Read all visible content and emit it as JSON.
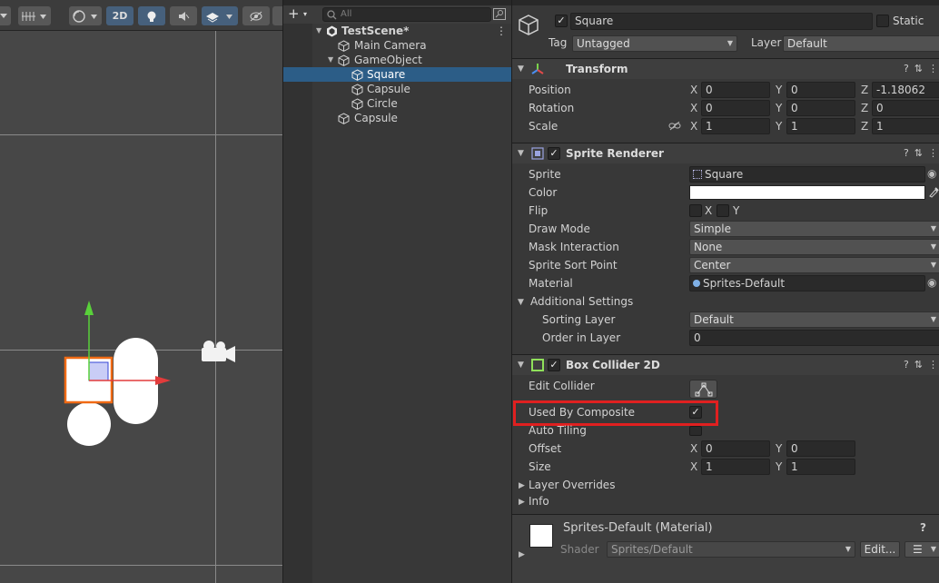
{
  "scene": {
    "mode_2d": "2D"
  },
  "hierarchy": {
    "search_placeholder": "All",
    "items": [
      {
        "label": "TestScene*"
      },
      {
        "label": "Main Camera"
      },
      {
        "label": "GameObject"
      },
      {
        "label": "Square"
      },
      {
        "label": "Capsule"
      },
      {
        "label": "Circle"
      },
      {
        "label": "Capsule"
      }
    ]
  },
  "inspector": {
    "object_name": "Square",
    "static_label": "Static",
    "tag_label": "Tag",
    "tag_value": "Untagged",
    "layer_label": "Layer",
    "layer_value": "Default",
    "transform": {
      "title": "Transform",
      "position_label": "Position",
      "rotation_label": "Rotation",
      "scale_label": "Scale",
      "position": {
        "x": "0",
        "y": "0",
        "z": "-1.18062"
      },
      "rotation": {
        "x": "0",
        "y": "0",
        "z": "0"
      },
      "scale": {
        "x": "1",
        "y": "1",
        "z": "1"
      },
      "axis_x": "X",
      "axis_y": "Y",
      "axis_z": "Z"
    },
    "sprite_renderer": {
      "title": "Sprite Renderer",
      "sprite_label": "Sprite",
      "sprite_value": "Square",
      "color_label": "Color",
      "color_value": "#ffffff",
      "flip_label": "Flip",
      "flip_x": "X",
      "flip_y": "Y",
      "draw_mode_label": "Draw Mode",
      "draw_mode_value": "Simple",
      "mask_label": "Mask Interaction",
      "mask_value": "None",
      "sort_point_label": "Sprite Sort Point",
      "sort_point_value": "Center",
      "material_label": "Material",
      "material_value": "Sprites-Default",
      "additional_label": "Additional Settings",
      "sorting_layer_label": "Sorting Layer",
      "sorting_layer_value": "Default",
      "order_label": "Order in Layer",
      "order_value": "0"
    },
    "box_collider": {
      "title": "Box Collider 2D",
      "edit_label": "Edit Collider",
      "used_by_composite_label": "Used By Composite",
      "auto_tiling_label": "Auto Tiling",
      "offset_label": "Offset",
      "offset": {
        "x": "0",
        "y": "0"
      },
      "size_label": "Size",
      "size": {
        "x": "1",
        "y": "1"
      },
      "layer_overrides_label": "Layer Overrides",
      "info_label": "Info"
    },
    "material": {
      "title": "Sprites-Default (Material)",
      "shader_label": "Shader",
      "shader_value": "Sprites/Default",
      "edit_button": "Edit..."
    }
  },
  "colors": {
    "selection": "#2c5d87",
    "highlight_box": "#e02020",
    "gizmo_x": "#e23b3b",
    "gizmo_y": "#59d13a",
    "selected_outline": "#f06a14"
  }
}
